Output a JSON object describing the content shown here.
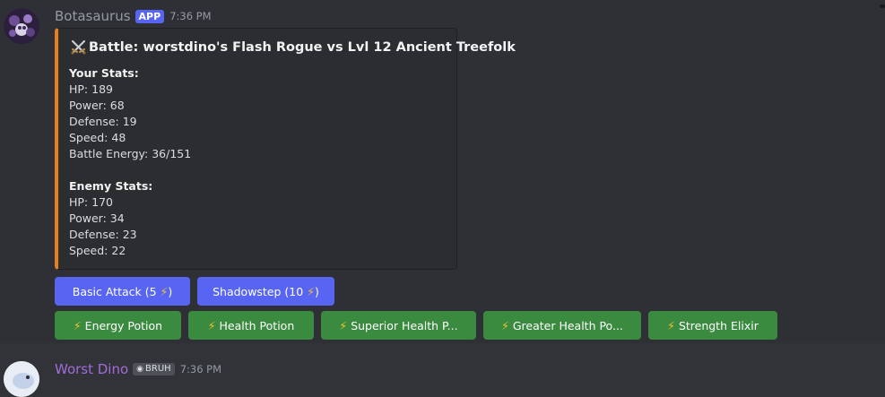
{
  "message": {
    "author": "Botasaurus",
    "badge": "APP",
    "time": "7:36 PM",
    "embed": {
      "accent_color": "#e67e22",
      "title": "Battle: worstdino's Flash Rogue vs Lvl 12 Ancient Treefolk",
      "title_icon": "crossed-swords-icon",
      "your_stats": {
        "heading": "Your Stats:",
        "lines": [
          "HP: 189",
          "Power: 68",
          "Defense: 19",
          "Speed: 48",
          "Battle Energy: 36/151"
        ]
      },
      "enemy_stats": {
        "heading": "Enemy Stats:",
        "lines": [
          "HP: 170",
          "Power: 34",
          "Defense: 23",
          "Speed: 22"
        ]
      }
    },
    "action_buttons": [
      {
        "label": "Basic Attack (5",
        "suffix": ")",
        "style": "primary"
      },
      {
        "label": "Shadowstep (10",
        "suffix": ")",
        "style": "primary"
      }
    ],
    "item_buttons": [
      {
        "label": "Energy Potion",
        "style": "success"
      },
      {
        "label": "Health Potion",
        "style": "success"
      },
      {
        "label": "Superior Health P...",
        "style": "success"
      },
      {
        "label": "Greater Health Po...",
        "style": "success"
      },
      {
        "label": "Strength Elixir",
        "style": "success"
      }
    ],
    "bolt_icon": "lightning-bolt-icon"
  },
  "next_message": {
    "author": "Worst Dino",
    "role_tag": "BRUH",
    "time": "7:36 PM"
  },
  "colors": {
    "background": "#313338",
    "primary_button": "#5865f2",
    "success_button": "#3a8b3f",
    "app_badge": "#5865f2",
    "next_author": "#a16cd9"
  }
}
